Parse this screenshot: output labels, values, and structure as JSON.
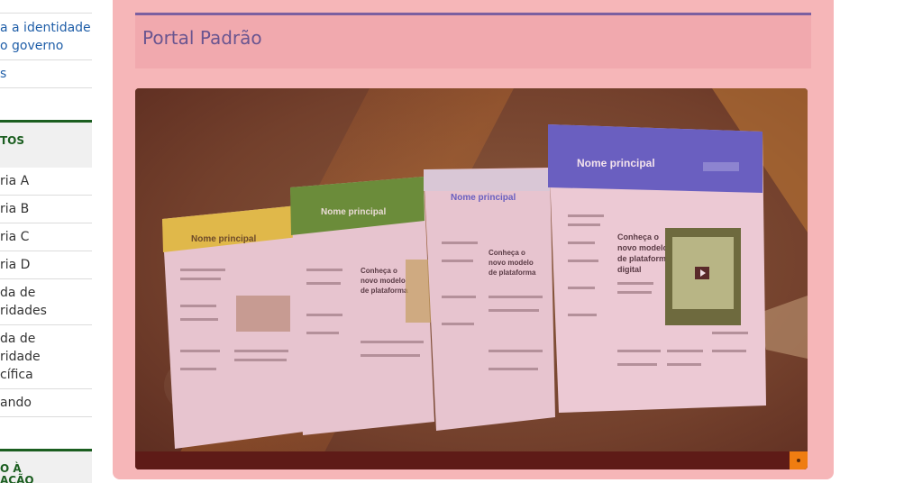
{
  "sidebar": {
    "top_links": [
      {
        "label": "a a identidade"
      },
      {
        "label": "o governo"
      },
      {
        "label": "s"
      }
    ],
    "section_1": {
      "header": "TOS",
      "items": [
        {
          "label": "ria A"
        },
        {
          "label": "ria B"
        },
        {
          "label": "ria C"
        },
        {
          "label": "ria D"
        },
        {
          "label_1": "da de",
          "label_2": "ridades"
        },
        {
          "label_1": "da de",
          "label_2": "ridade",
          "label_3": "cífica"
        },
        {
          "label": "ando"
        }
      ]
    },
    "section_2": {
      "header_1": "O À",
      "header_2": "AÇÃO"
    }
  },
  "main": {
    "title": "Portal Padrão",
    "colors": {
      "panel": "#f6b6b8",
      "header_bg": "#f1a9ae",
      "header_border": "#7b5fa0",
      "title": "#6a5590",
      "slide_dot": "#ef7d11"
    },
    "carousel": {
      "slide_indicators": 1,
      "mockup_headings": [
        "Nome principal",
        "Nome principal",
        "Nome principal",
        "Nome principal"
      ],
      "mockup_feature_text": "Conheça o novo modelo de plataforma digital",
      "mockup_header_colors": [
        "#e0b84a",
        "#6b8c3a",
        "#d9c7d6",
        "#6a5fc0"
      ]
    }
  }
}
